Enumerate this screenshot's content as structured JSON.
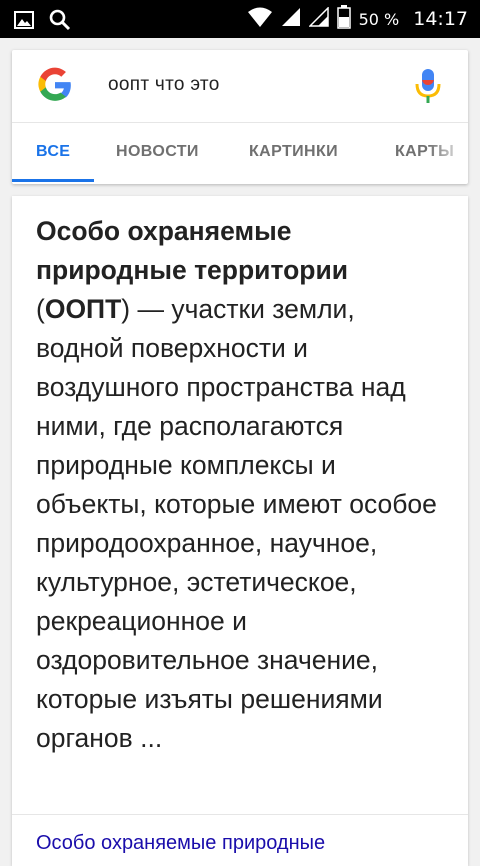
{
  "status_bar": {
    "battery_percent": "50 %",
    "time": "14:17",
    "icons": [
      "image-icon",
      "search-icon",
      "wifi-icon",
      "signal-icon",
      "signal-icon",
      "battery-icon"
    ]
  },
  "search": {
    "query": "оопт что это",
    "logo": "google-logo",
    "mic_icon": "mic-icon"
  },
  "tabs": [
    {
      "label": "ВСЕ",
      "active": true
    },
    {
      "label": "НОВОСТИ",
      "active": false
    },
    {
      "label": "КАРТИНКИ",
      "active": false
    },
    {
      "label": "КАРТЫ",
      "active": false
    }
  ],
  "result": {
    "title_bold": "Особо охраняемые природные территории",
    "paren_open": " (",
    "abbr_bold": "ООПТ",
    "body": ") — участки земли, водной поверхности и воздушного пространства над ними, где располагаются природные комплексы и объекты, которые имеют особое природоохранное, научное, культурное, эстетическое, рекреационное и оздоровительное значение, которые изъяты решениями органов ...",
    "link_text": "Особо охраняемые природные"
  },
  "colors": {
    "accent": "#1a73e8",
    "link": "#1a0dab",
    "status_bar": "#000000"
  }
}
